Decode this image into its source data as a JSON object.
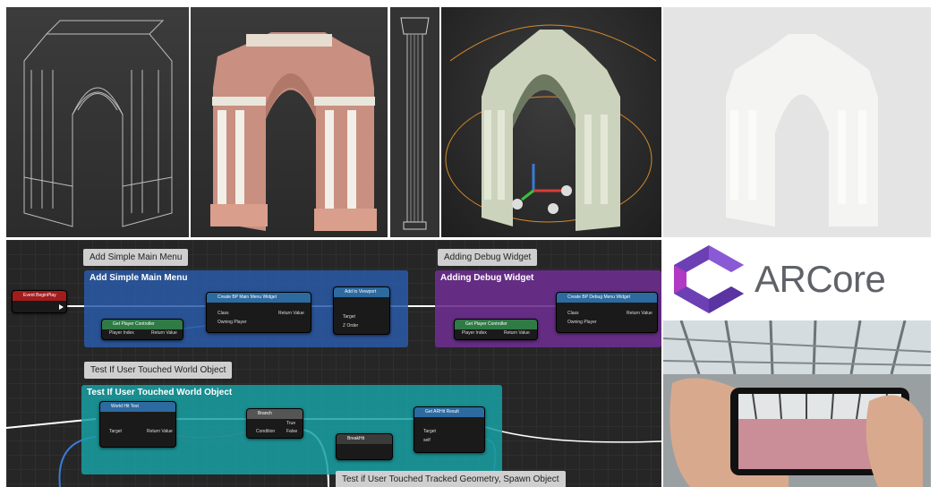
{
  "blueprint": {
    "comments": [
      {
        "label": "Add Simple Main Menu",
        "title": "Add Simple Main Menu",
        "color": "#2a5aa8"
      },
      {
        "label": "Adding Debug Widget",
        "title": "Adding Debug Widget",
        "color": "#6b2f8e"
      },
      {
        "label": "Test If User Touched World Object",
        "title": "Test If User Touched World Object",
        "color": "#17a0a3"
      },
      {
        "label": "Test if User Touched Tracked Geometry, Spawn Object"
      }
    ],
    "nodes": {
      "event_begin_play": "Event BeginPlay",
      "create_main_menu": "Create BP Main Menu Widget",
      "add_to_viewport": "Add to Viewport",
      "get_player_controller_1": "Get Player Controller",
      "create_debug_menu": "Create BP Debug Menu Widget",
      "get_player_controller_2": "Get Player Controller",
      "world_hit_test": "World Hit Test",
      "branch": "Branch",
      "line_trace": "Get ARHit Result",
      "breakhit": "BreakHit"
    },
    "pins": {
      "class": "Class",
      "owning_player": "Owning Player",
      "return_value": "Return Value",
      "player_index": "Player Index",
      "target": "Target",
      "z_order": "Z Order",
      "condition": "Condition",
      "true": "True",
      "false": "False",
      "self": "self"
    }
  },
  "logo": {
    "text": "ARCore",
    "colors": [
      "#4285f4",
      "#7e57c2",
      "#9c27b0"
    ]
  }
}
